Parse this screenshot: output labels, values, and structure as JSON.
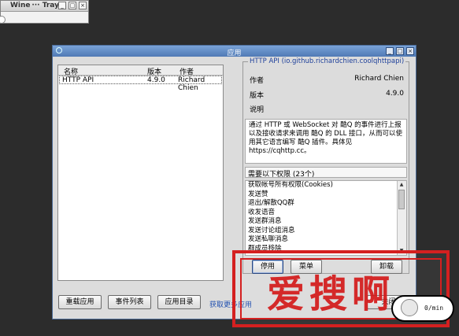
{
  "tray_window": {
    "title": "Wine ··· Tray"
  },
  "dialog": {
    "title": "应用",
    "list": {
      "columns": [
        "名称",
        "版本",
        "作者"
      ],
      "rows": [
        {
          "name": "HTTP API",
          "version": "4.9.0",
          "author": "Richard Chien"
        }
      ]
    },
    "info": {
      "legend": "HTTP API (io.github.richardchien.coolqhttpapi)",
      "author_label": "作者",
      "author_value": "Richard Chien",
      "version_label": "版本",
      "version_value": "4.9.0",
      "desc_label": "说明",
      "description": "通过 HTTP 或 WebSocket 对 酷Q 的事件进行上报以及接收请求来调用 酷Q 的 DLL 接口，从而可以使用其它语言编写 酷Q 插件。具体见 https://cqhttp.cc。",
      "permissions_header": "需要以下权限 (23个)",
      "permissions": [
        "获取帐号所有权限(Cookies)",
        "发送赞",
        "退出/解散QQ群",
        "收发语音",
        "发送群消息",
        "发送讨论组消息",
        "发送私聊消息",
        "群成员移除"
      ]
    },
    "buttons": {
      "disable": "停用",
      "menu": "菜单",
      "uninstall": "卸载",
      "reload": "重载应用",
      "events": "事件列表",
      "app_dir": "应用目录",
      "more": "获取更多应用",
      "close": "关闭"
    }
  },
  "watermark": {
    "text": "爱搜啊"
  },
  "clock": {
    "label": "0/min"
  }
}
